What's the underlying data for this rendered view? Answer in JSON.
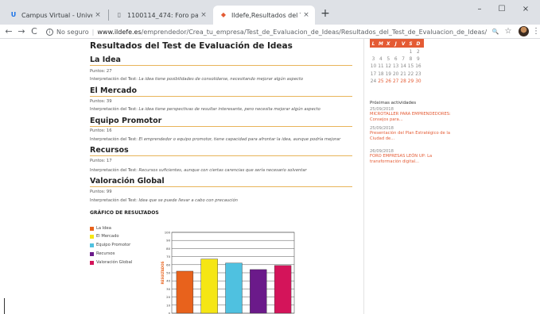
{
  "browser": {
    "tabs": [
      {
        "label": "Campus Virtual - Universidad Na",
        "favicon": "U",
        "close": "×"
      },
      {
        "label": "1100114_474: Foro paso 2 Defini",
        "favicon": "▯",
        "close": "×"
      },
      {
        "label": "Ildefe,Resultados del Test de Eva",
        "favicon": "◆",
        "close": "×"
      }
    ],
    "new_tab": "+",
    "window_controls": {
      "minimize": "–",
      "maximize": "☐",
      "close": "×"
    },
    "nav": {
      "back": "←",
      "forward": "→",
      "reload": "C"
    },
    "address": {
      "security_label": "No seguro",
      "divider": "|",
      "url_host": "www.ildefe.es",
      "url_path": "/emprendedor/Crea_tu_empresa/Test_de_Evaluacion_de_Ideas/Resultados_del_Test_de_Evaluacion_de_Ideas/"
    },
    "toolbar_icons": {
      "zoom": "🔍",
      "bookmark": "☆",
      "menu": "⋮"
    }
  },
  "page": {
    "title": "Resultados del Test de Evaluación de Ideas",
    "sections": [
      {
        "heading": "La Idea",
        "points_label": "Puntos: 27",
        "interp_prefix": "Interpretación del Test:",
        "interp_text": "La idea tiene posibilidades de consolidarse, necesitando mejorar algún aspecto"
      },
      {
        "heading": "El Mercado",
        "points_label": "Puntos: 39",
        "interp_prefix": "Interpretación del Test:",
        "interp_text": "La idea tiene perspectivas de resultar interesante, pero necesita mejorar algún aspecto"
      },
      {
        "heading": "Equipo Promotor",
        "points_label": "Puntos: 16",
        "interp_prefix": "Interpretación del Test:",
        "interp_text": "El emprendedor o equipo promotor, tiene capacidad para afrontar la idea, aunque podría mejorar"
      },
      {
        "heading": "Recursos",
        "points_label": "Puntos: 17",
        "interp_prefix": "Interpretación del Test:",
        "interp_text": "Recursos suficientes, aunque con ciertas carencias que sería necesario solventar"
      },
      {
        "heading": "Valoración Global",
        "points_label": "Puntos: 99",
        "interp_prefix": "Interpretación del Test:",
        "interp_text": "Idea que se puede llevar a cabo con precaución"
      }
    ],
    "graph_title": "GRÁFICO DE RESULTADOS"
  },
  "chart_data": {
    "type": "bar",
    "categories": [
      "La Idea",
      "El Mercado",
      "Equipo Promotor",
      "Recursos",
      "Valoración Global"
    ],
    "values": [
      52,
      67,
      62,
      54,
      59
    ],
    "colors": [
      "#e8621c",
      "#f5e614",
      "#4fc1e0",
      "#6b1a8a",
      "#d4145a"
    ],
    "ylabel": "RESULTADOS",
    "ylim": [
      0,
      100
    ],
    "yticks": [
      "0",
      "10",
      "20",
      "30",
      "40",
      "50",
      "60",
      "70",
      "80",
      "90",
      "100"
    ],
    "grid": true,
    "legend": "left"
  },
  "sidebar": {
    "calendar": {
      "day_headers": [
        "L",
        "M",
        "X",
        "J",
        "V",
        "S",
        "D"
      ],
      "weeks": [
        [
          "",
          "",
          "",
          "",
          "",
          "1",
          "2"
        ],
        [
          "3",
          "4",
          "5",
          "6",
          "7",
          "8",
          "9"
        ],
        [
          "10",
          "11",
          "12",
          "13",
          "14",
          "15",
          "16"
        ],
        [
          "17",
          "18",
          "19",
          "20",
          "21",
          "22",
          "23"
        ],
        [
          "24",
          "25",
          "26",
          "27",
          "28",
          "29",
          "30"
        ]
      ],
      "accent_color": "#e45b34"
    },
    "upcoming_title": "Próximas actividades",
    "events": [
      {
        "date": "25/09/2018",
        "title": "MICROTALLER PARA EMPRENDEDORES: Consejos para..."
      },
      {
        "date": "25/09/2018",
        "title": "Presentación del Plan Estratégico de la Ciudad de..."
      },
      {
        "date": "26/09/2018",
        "title": "FORO EMPRESAS LEÓN UP: La transformación digital..."
      }
    ]
  }
}
